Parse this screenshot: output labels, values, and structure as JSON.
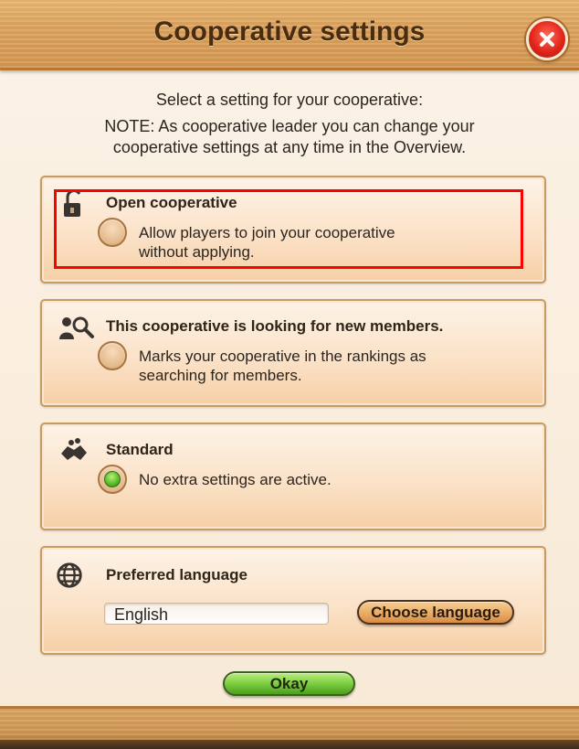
{
  "dialog": {
    "title": "Cooperative settings",
    "close_icon": "close-icon",
    "intro_line1": "Select a setting for your cooperative:",
    "intro_line2": "NOTE: As cooperative leader you can change your",
    "intro_line3": "cooperative settings at any time in the Overview."
  },
  "options": [
    {
      "icon": "open-lock-icon",
      "title": "Open cooperative",
      "desc_line1": "Allow players to join your cooperative",
      "desc_line2": "without applying.",
      "selected": false
    },
    {
      "icon": "person-search-icon",
      "title": "This cooperative is looking for new members.",
      "desc_line1": "Marks your cooperative in the rankings as",
      "desc_line2": "searching for members.",
      "selected": false
    },
    {
      "icon": "handshake-icon",
      "title": "Standard",
      "desc_line1": "No extra settings are active.",
      "desc_line2": "",
      "selected": true
    }
  ],
  "language": {
    "icon": "globe-icon",
    "title": "Preferred language",
    "value": "English",
    "button_label": "Choose language"
  },
  "footer": {
    "okay_label": "Okay"
  },
  "colors": {
    "title_text": "#4a2d10",
    "highlight": "#ff0000",
    "selected_radio": "#5bbf2a",
    "okay_button": "#77c93d"
  }
}
